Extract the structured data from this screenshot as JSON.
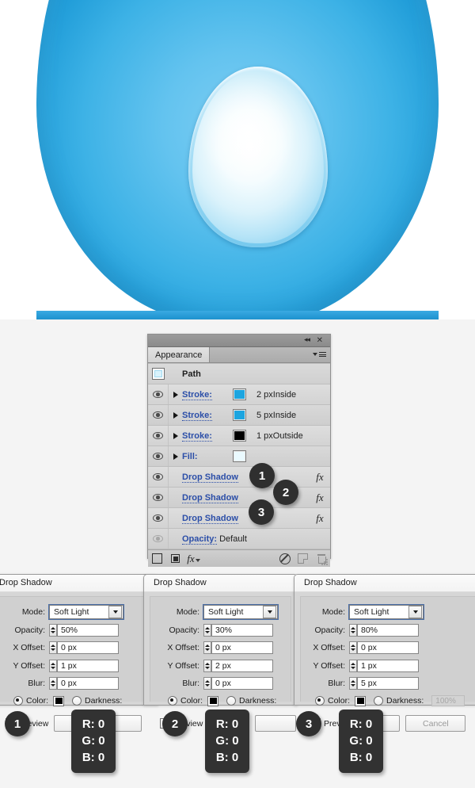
{
  "artwork": {
    "alt": "blue egg illustration with inner highlight",
    "outer_color": "#3db2e6",
    "inner_color": "#ffffff",
    "rim_color": "#a9dff6"
  },
  "panel": {
    "tab_label": "Appearance",
    "window_controls": {
      "collapse": "◂◂",
      "close": "✕"
    },
    "path_row": {
      "label": "Path",
      "icon": "path-thumbnail-icon"
    },
    "rows": [
      {
        "type": "stroke",
        "label": "Stroke:",
        "swatch": "#1ca5e0",
        "value": "2 px",
        "value2": "Inside",
        "visible": true
      },
      {
        "type": "stroke",
        "label": "Stroke:",
        "swatch": "#1ca5e0",
        "value": "5 px",
        "value2": "Inside",
        "visible": true
      },
      {
        "type": "stroke",
        "label": "Stroke:",
        "swatch": "#000000",
        "value": "1 px",
        "value2": "Outside",
        "visible": true
      },
      {
        "type": "fill",
        "label": "Fill:",
        "swatch": "#eafaff",
        "value": "",
        "value2": "",
        "visible": true
      },
      {
        "type": "effect",
        "label": "Drop Shadow",
        "badge": "1",
        "fx": "fx",
        "visible": true
      },
      {
        "type": "effect",
        "label": "Drop Shadow",
        "badge": "2",
        "fx": "fx",
        "visible": true
      },
      {
        "type": "effect",
        "label": "Drop Shadow",
        "badge": "3",
        "fx": "fx",
        "visible": true
      },
      {
        "type": "opacity",
        "label": "Opacity:",
        "value": "Default",
        "visible": false
      }
    ],
    "footer_icons": [
      "add-new-stroke-icon",
      "add-new-fill-icon",
      "add-new-effect-icon",
      "clear-appearance-icon",
      "duplicate-item-icon",
      "delete-item-icon",
      "resize-grip-icon"
    ]
  },
  "dialogs": [
    {
      "badge": "1",
      "title": "Drop Shadow",
      "fields": {
        "mode_label": "Mode:",
        "mode_value": "Soft Light",
        "opacity_label": "Opacity:",
        "opacity_value": "50%",
        "x_offset_label": "X Offset:",
        "x_offset_value": "0 px",
        "y_offset_label": "Y Offset:",
        "y_offset_value": "1 px",
        "blur_label": "Blur:",
        "blur_value": "0 px"
      },
      "color_label": "Color:",
      "color_value": "#000000",
      "darkness_label": "Darkness:",
      "darkness_value": "",
      "preview_label": "Preview",
      "buttons": [
        "",
        ""
      ],
      "tooltip": {
        "r": "R: 0",
        "g": "G: 0",
        "b": "B: 0"
      }
    },
    {
      "badge": "2",
      "title": "Drop Shadow",
      "fields": {
        "mode_label": "Mode:",
        "mode_value": "Soft Light",
        "opacity_label": "Opacity:",
        "opacity_value": "30%",
        "x_offset_label": "X Offset:",
        "x_offset_value": "0 px",
        "y_offset_label": "Y Offset:",
        "y_offset_value": "2 px",
        "blur_label": "Blur:",
        "blur_value": "0 px"
      },
      "color_label": "Color:",
      "color_value": "#000000",
      "darkness_label": "Darkness:",
      "darkness_value": "",
      "preview_label": "Preview",
      "buttons": [
        "",
        ""
      ],
      "tooltip": {
        "r": "R: 0",
        "g": "G: 0",
        "b": "B: 0"
      }
    },
    {
      "badge": "3",
      "title": "Drop Shadow",
      "fields": {
        "mode_label": "Mode:",
        "mode_value": "Soft Light",
        "opacity_label": "Opacity:",
        "opacity_value": "80%",
        "x_offset_label": "X Offset:",
        "x_offset_value": "0 px",
        "y_offset_label": "Y Offset:",
        "y_offset_value": "1 px",
        "blur_label": "Blur:",
        "blur_value": "5 px"
      },
      "color_label": "Color:",
      "color_value": "#000000",
      "darkness_label": "Darkness:",
      "darkness_value": "100%",
      "preview_label": "Preview",
      "buttons": [
        "",
        "Cancel"
      ],
      "tooltip": {
        "r": "R: 0",
        "g": "G: 0",
        "b": "B: 0"
      }
    }
  ]
}
